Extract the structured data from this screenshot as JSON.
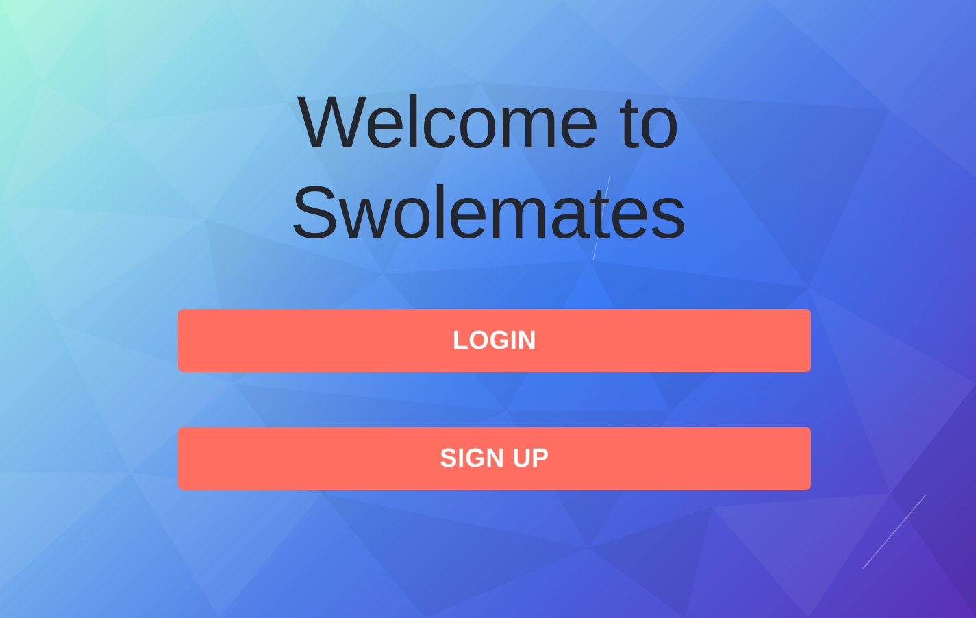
{
  "welcome": {
    "line1": "Welcome to",
    "line2": "Swolemates"
  },
  "buttons": {
    "login_label": "LOGIN",
    "signup_label": "SIGN UP"
  },
  "colors": {
    "button_bg": "#fe6e61",
    "button_text": "#ffffff",
    "title_text": "#23262d",
    "bg_top_left": "#a8f7dc",
    "bg_bottom_right": "#5a2fb5"
  }
}
